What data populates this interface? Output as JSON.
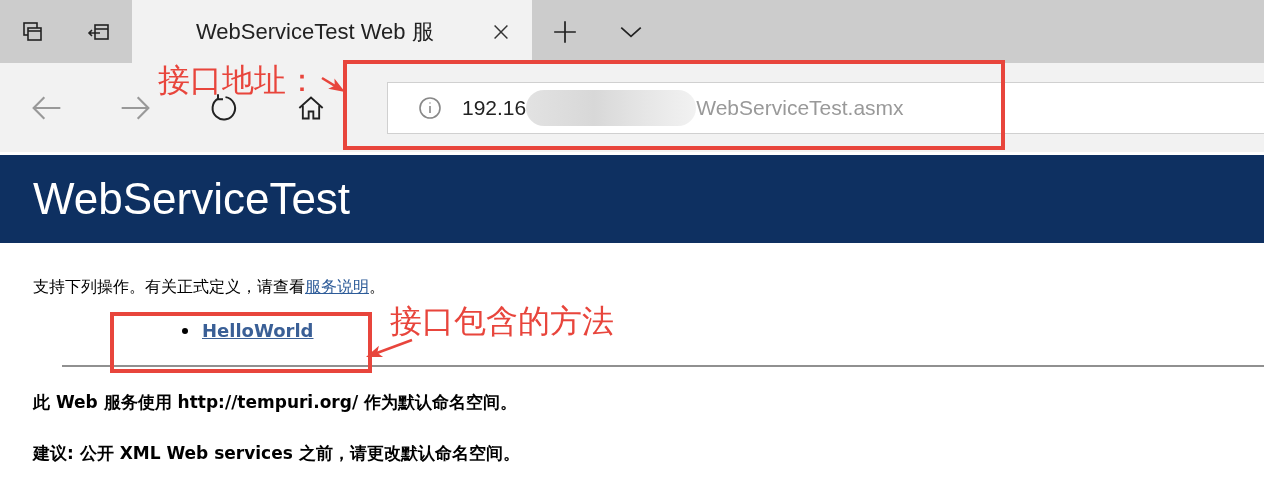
{
  "browser": {
    "tab": {
      "title": "WebServiceTest Web 服",
      "selected": true
    },
    "address": {
      "host": "192.16",
      "path": "WebServiceTest.asmx",
      "redacted": true
    }
  },
  "page": {
    "header": "WebServiceTest",
    "intro": {
      "text": "支持下列操作。有关正式定义，请查看",
      "link": "服务说明",
      "end": "。"
    },
    "operations": [
      "HelloWorld"
    ],
    "notes": [
      "此 Web 服务使用 http://tempuri.org/ 作为默认命名空间。",
      "建议: 公开 XML Web services 之前，请更改默认命名空间。"
    ]
  },
  "annotations": [
    {
      "label": "接口地址：",
      "kind": "address"
    },
    {
      "label": "接口包含的方法",
      "kind": "operations"
    }
  ]
}
